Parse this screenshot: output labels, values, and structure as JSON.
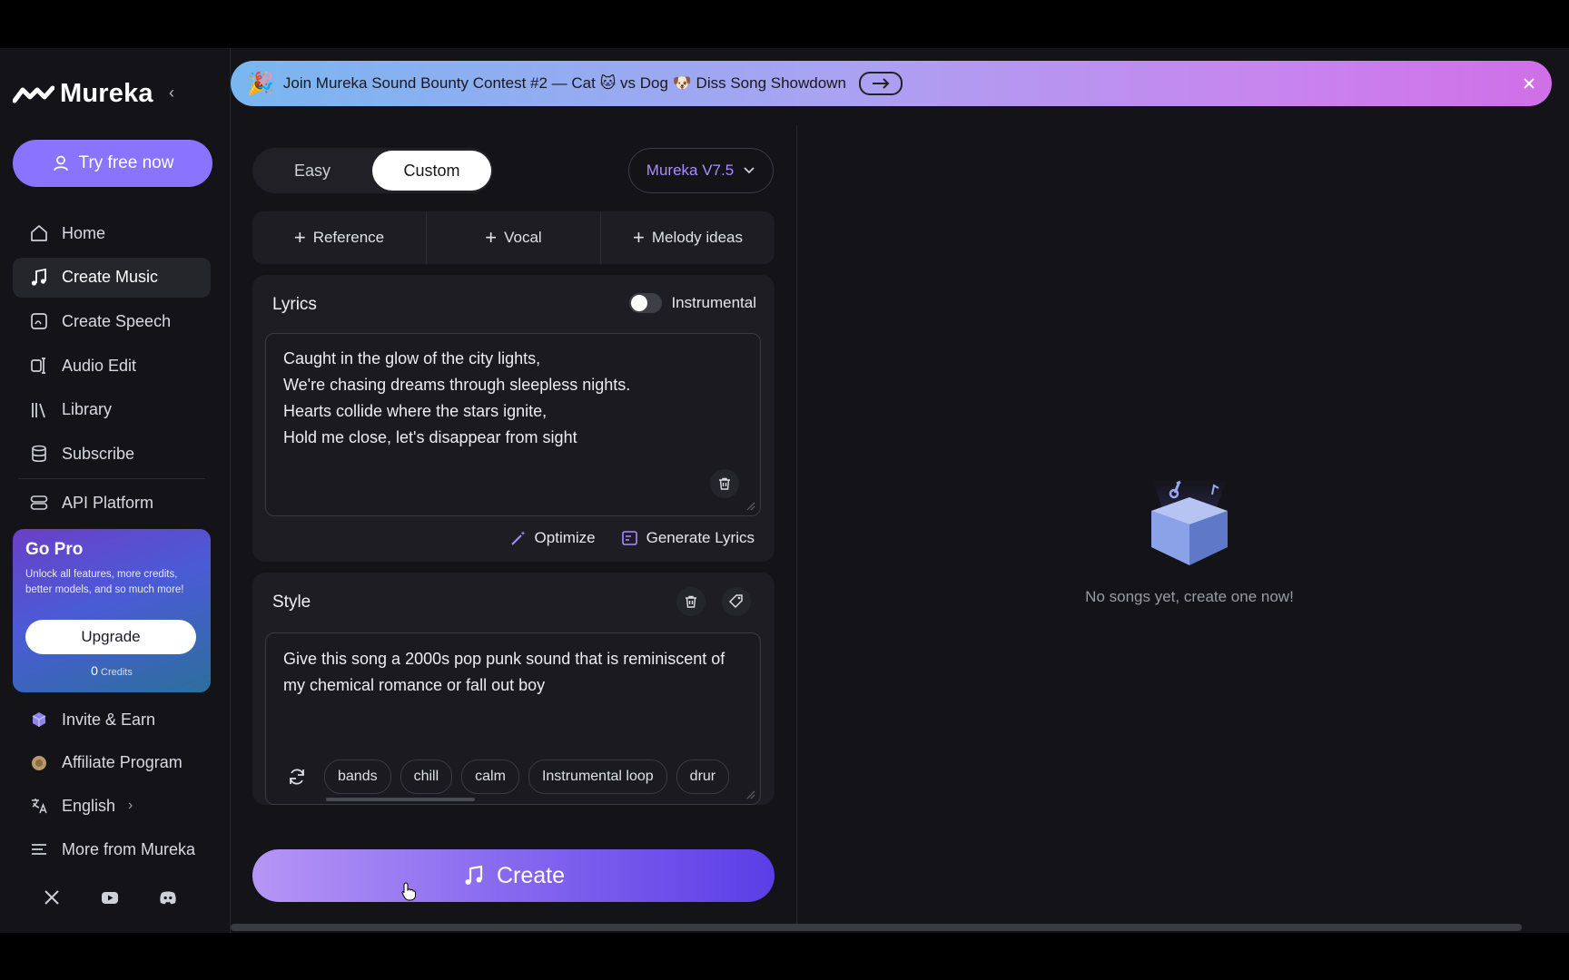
{
  "app": {
    "name": "Mureka"
  },
  "sidebar": {
    "try_free": "Try free now",
    "items": [
      {
        "label": "Home",
        "icon": "home-icon",
        "active": false
      },
      {
        "label": "Create Music",
        "icon": "music-note-icon",
        "active": true
      },
      {
        "label": "Create Speech",
        "icon": "speech-icon",
        "active": false
      },
      {
        "label": "Audio Edit",
        "icon": "audio-edit-icon",
        "active": false
      },
      {
        "label": "Library",
        "icon": "library-icon",
        "active": false
      },
      {
        "label": "Subscribe",
        "icon": "database-icon",
        "active": false
      },
      {
        "label": "API Platform",
        "icon": "api-icon",
        "active": false
      }
    ],
    "gopro": {
      "title": "Go Pro",
      "description": "Unlock all features, more credits, better models, and so much more!",
      "upgrade": "Upgrade",
      "credits_value": "0",
      "credits_label": "Credits"
    },
    "bottom_items": [
      {
        "label": "Invite & Earn",
        "icon": "invite-icon"
      },
      {
        "label": "Affiliate Program",
        "icon": "affiliate-icon"
      },
      {
        "label": "English",
        "icon": "language-icon"
      },
      {
        "label": "More from Mureka",
        "icon": "menu-icon"
      }
    ],
    "social": [
      "x-icon",
      "youtube-icon",
      "discord-icon"
    ]
  },
  "banner": {
    "text": "Join Mureka Sound Bounty Contest #2 — Cat 🐱 vs Dog 🐶 Diss Song Showdown"
  },
  "mode": {
    "easy": "Easy",
    "custom": "Custom",
    "selected": "Custom"
  },
  "model": {
    "selected": "Mureka V7.5"
  },
  "add_buttons": [
    "Reference",
    "Vocal",
    "Melody ideas"
  ],
  "lyrics": {
    "title": "Lyrics",
    "instrumental_label": "Instrumental",
    "instrumental_on": false,
    "lines": [
      "Caught in the glow of the city lights,",
      "We're chasing dreams through sleepless nights.",
      "Hearts collide where the stars ignite,",
      "Hold me close, let's disappear from sight"
    ],
    "optimize": "Optimize",
    "generate": "Generate Lyrics"
  },
  "style": {
    "title": "Style",
    "text": "Give this song a 2000s pop punk sound that is reminiscent of my chemical romance or fall out boy",
    "tags": [
      "bands",
      "chill",
      "calm",
      "Instrumental loop",
      "drur"
    ]
  },
  "create": {
    "label": "Create"
  },
  "results": {
    "empty_text": "No songs yet, create one now!"
  },
  "colors": {
    "accent": "#8a73ff",
    "card": "#1d1d23",
    "bg": "#141418"
  }
}
